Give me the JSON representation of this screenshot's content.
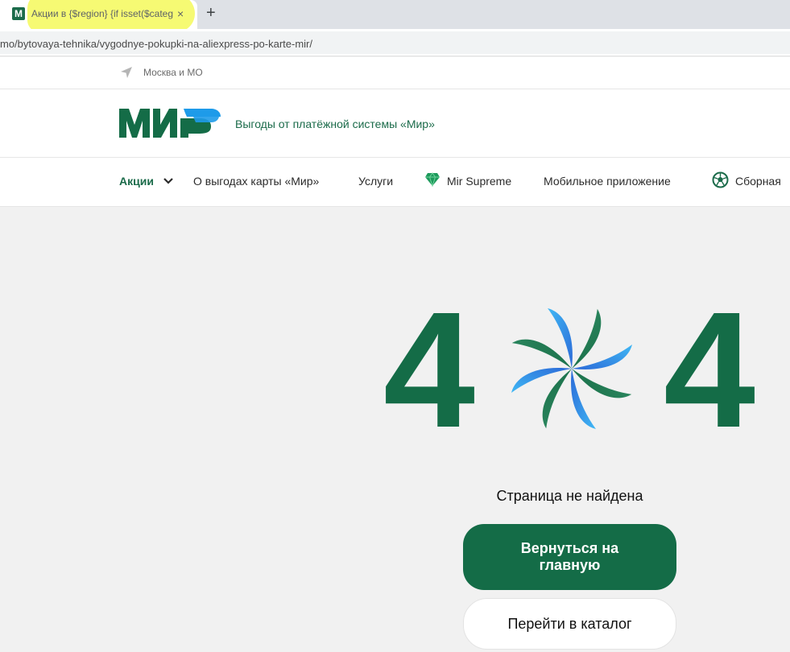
{
  "browser": {
    "tab_title": "Акции в {$region} {if isset($categ",
    "tab_favicon": "М",
    "close_glyph": "×",
    "new_tab_glyph": "+",
    "url": "mo/bytovaya-tehnika/vygodnye-pokupki-na-aliexpress-po-karte-mir/"
  },
  "header": {
    "location_icon": "location-arrow-icon",
    "location": "Москва и МО",
    "logo_alt": "МИР",
    "tagline": "Выгоды от платёжной системы «Мир»"
  },
  "nav": {
    "items": [
      {
        "label": "Акции",
        "active": true,
        "icon": "chevron-down-icon"
      },
      {
        "label": "О выгодах карты «Мир»"
      },
      {
        "label": "Услуги"
      },
      {
        "label": "Mir Supreme",
        "icon": "diamond-icon"
      },
      {
        "label": "Мобильное приложение"
      },
      {
        "label": "Сборная",
        "icon": "soccer-ball-icon"
      }
    ]
  },
  "error": {
    "code_left": "4",
    "code_right": "4",
    "message": "Страница не найдена",
    "home_button": "Вернуться на главную",
    "catalog_button": "Перейти в каталог"
  },
  "colors": {
    "brand_green": "#146c47",
    "brand_blue": "#1e9be9",
    "tab_highlight": "#f4f95a"
  }
}
